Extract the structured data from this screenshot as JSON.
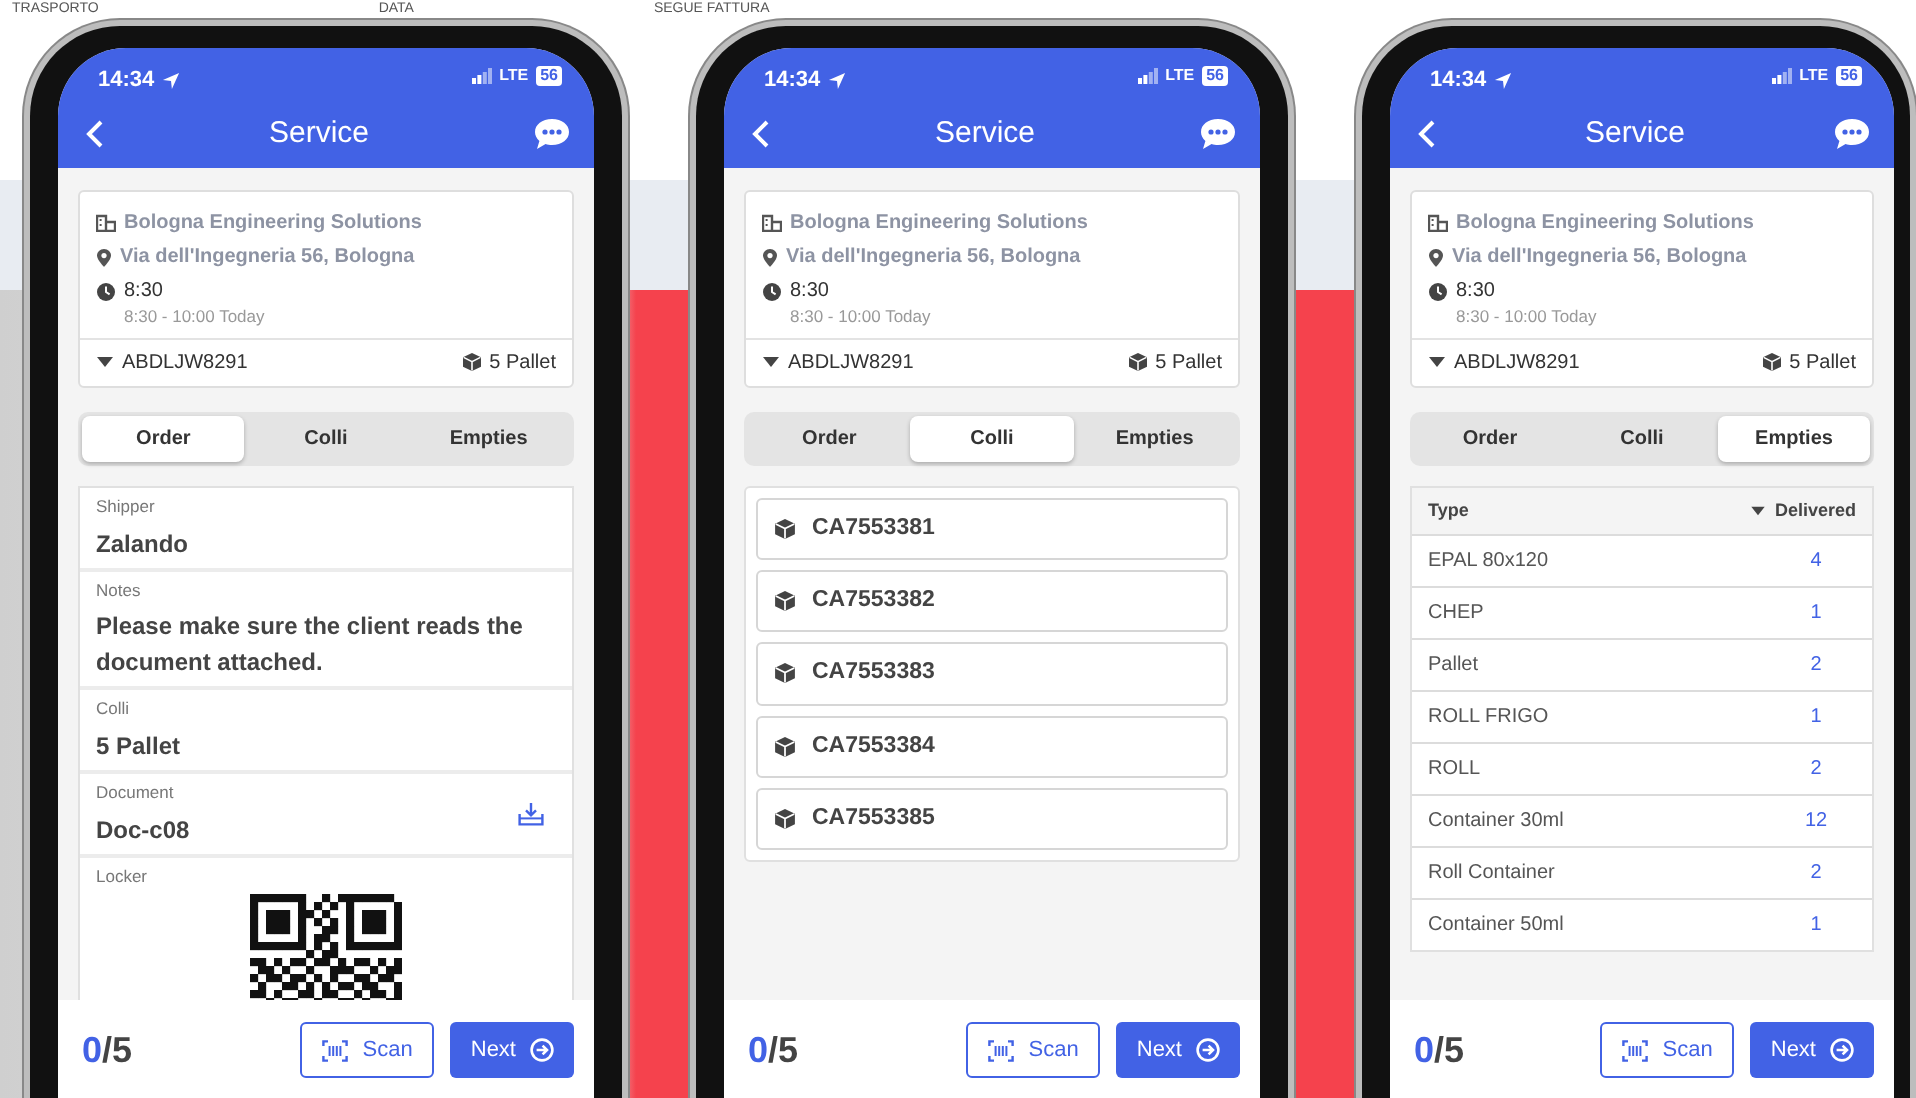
{
  "backdrop": {
    "texts": [
      "TRASPORTO",
      "DATA",
      "SEGUE FATTURA"
    ]
  },
  "phones": [
    {
      "status": {
        "time": "14:34",
        "network": "LTE",
        "battery": "56"
      },
      "header": {
        "title": "Service"
      },
      "stop": {
        "company": "Bologna Engineering Solutions",
        "address": "Via dell'Ingegneria 56, Bologna",
        "time": "8:30",
        "window": "8:30 - 10:00 Today",
        "order": "ABDLJW8291",
        "load": "5 Pallet"
      },
      "tabs": [
        {
          "label": "Order",
          "selected": true
        },
        {
          "label": "Colli",
          "selected": false
        },
        {
          "label": "Empties",
          "selected": false
        }
      ],
      "content": {
        "kind": "details",
        "fields": [
          {
            "kind": "text",
            "label": "Shipper",
            "value": "Zalando"
          },
          {
            "kind": "text",
            "label": "Notes",
            "value": "Please make sure the client reads the document attached."
          },
          {
            "kind": "text",
            "label": "Colli",
            "value": "5 Pallet"
          },
          {
            "kind": "download",
            "label": "Document",
            "value": "Doc-c08"
          },
          {
            "kind": "qr",
            "label": "Locker"
          }
        ]
      },
      "footer": {
        "done": "0",
        "total": "/5",
        "scan": "Scan",
        "next": "Next"
      }
    },
    {
      "status": {
        "time": "14:34",
        "network": "LTE",
        "battery": "56"
      },
      "header": {
        "title": "Service"
      },
      "stop": {
        "company": "Bologna Engineering Solutions",
        "address": "Via dell'Ingegneria 56, Bologna",
        "time": "8:30",
        "window": "8:30 - 10:00 Today",
        "order": "ABDLJW8291",
        "load": "5 Pallet"
      },
      "tabs": [
        {
          "label": "Order",
          "selected": false
        },
        {
          "label": "Colli",
          "selected": true
        },
        {
          "label": "Empties",
          "selected": false
        }
      ],
      "content": {
        "kind": "colli",
        "items": [
          "CA7553381",
          "CA7553382",
          "CA7553383",
          "CA7553384",
          "CA7553385"
        ]
      },
      "footer": {
        "done": "0",
        "total": "/5",
        "scan": "Scan",
        "next": "Next"
      }
    },
    {
      "status": {
        "time": "14:34",
        "network": "LTE",
        "battery": "56"
      },
      "header": {
        "title": "Service"
      },
      "stop": {
        "company": "Bologna Engineering Solutions",
        "address": "Via dell'Ingegneria 56, Bologna",
        "time": "8:30",
        "window": "8:30 - 10:00 Today",
        "order": "ABDLJW8291",
        "load": "5 Pallet"
      },
      "tabs": [
        {
          "label": "Order",
          "selected": false
        },
        {
          "label": "Colli",
          "selected": false
        },
        {
          "label": "Empties",
          "selected": true
        }
      ],
      "content": {
        "kind": "empties",
        "columns": [
          "Type",
          "Delivered"
        ],
        "rows": [
          {
            "type": "EPAL 80x120",
            "delivered": "4"
          },
          {
            "type": "CHEP",
            "delivered": "1"
          },
          {
            "type": "Pallet",
            "delivered": "2"
          },
          {
            "type": "ROLL FRIGO",
            "delivered": "1"
          },
          {
            "type": "ROLL",
            "delivered": "2"
          },
          {
            "type": "Container 30ml",
            "delivered": "12"
          },
          {
            "type": "Roll Container",
            "delivered": "2"
          },
          {
            "type": "Container 50ml",
            "delivered": "1"
          }
        ]
      },
      "footer": {
        "done": "0",
        "total": "/5",
        "scan": "Scan",
        "next": "Next"
      }
    }
  ]
}
